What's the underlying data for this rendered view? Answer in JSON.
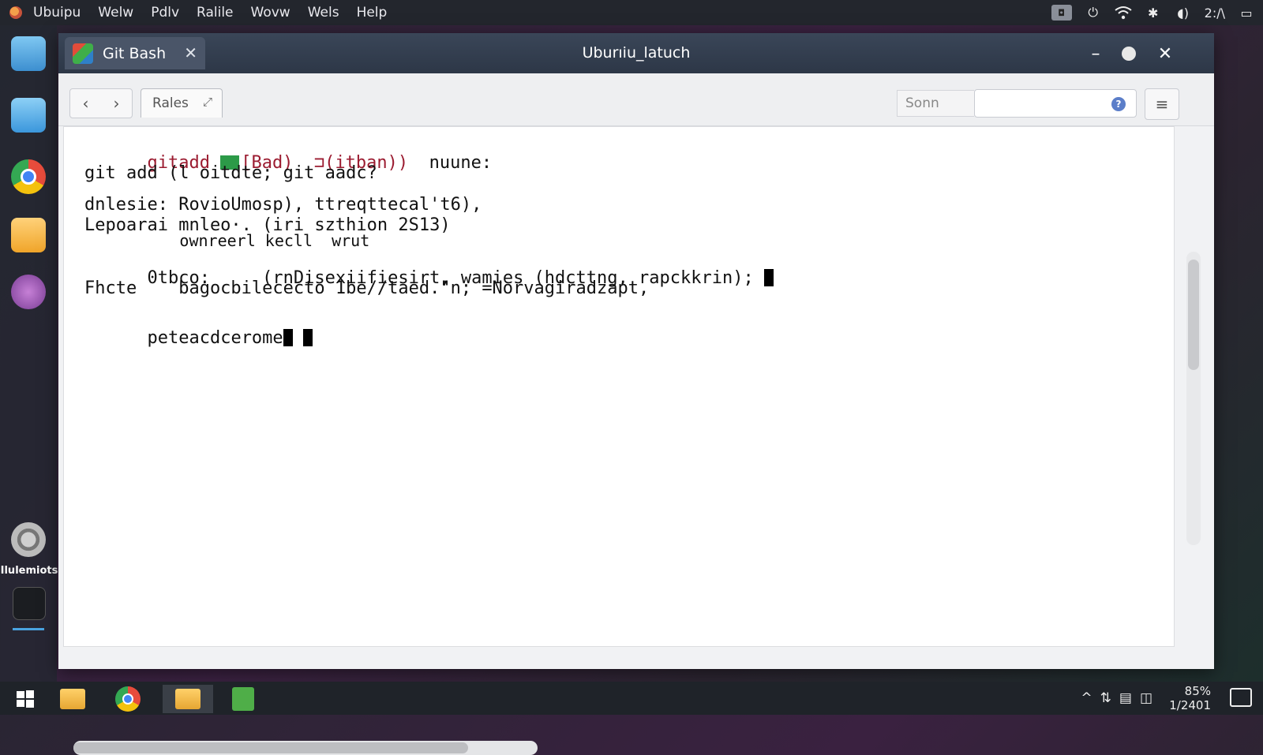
{
  "topbar": {
    "menus": [
      "Ubuipu",
      "Welw",
      "Pdlv",
      "Ralile",
      "Wovw",
      "Wels",
      "Help"
    ],
    "clock": "2:/\\"
  },
  "dock": {
    "label": "Ilulemiots"
  },
  "window": {
    "tab_title": "Git Bash",
    "title": "Uburıiu_lаtuch"
  },
  "toolbar": {
    "tab_label": "Rales",
    "search_label": "Sonn",
    "search_value": ""
  },
  "terminal": {
    "lines": [
      {
        "part1": "gitadd ",
        "part2": "[Bad)  ⊐(itban))",
        "part3": "  nuune:"
      },
      {
        "text": "git add (l oitdte; git aadc?"
      },
      {
        "text": "dnlesie: RovioUmosp), ttreqttecal't6),"
      },
      {
        "text": "Lepoarai mnleo·. (iri szthion 2S13)"
      },
      {
        "text": "          ownreerl kecll  wrut"
      },
      {
        "text": "0tbco:     (rnDisexiifiesirt, wamies (hdcttng, rapckkrin); "
      },
      {
        "text": "Fhcte    bagocbilececto 1be//taed.\"n; =Norvagiradzapt,"
      },
      {
        "text": "peteacdcerome"
      }
    ]
  },
  "taskbar": {
    "battery": "85%",
    "date": "1/2401"
  },
  "colors": {
    "accent_red": "#9b1b30",
    "accent_green": "#2c9a48",
    "titlebar": "#2d3747"
  }
}
